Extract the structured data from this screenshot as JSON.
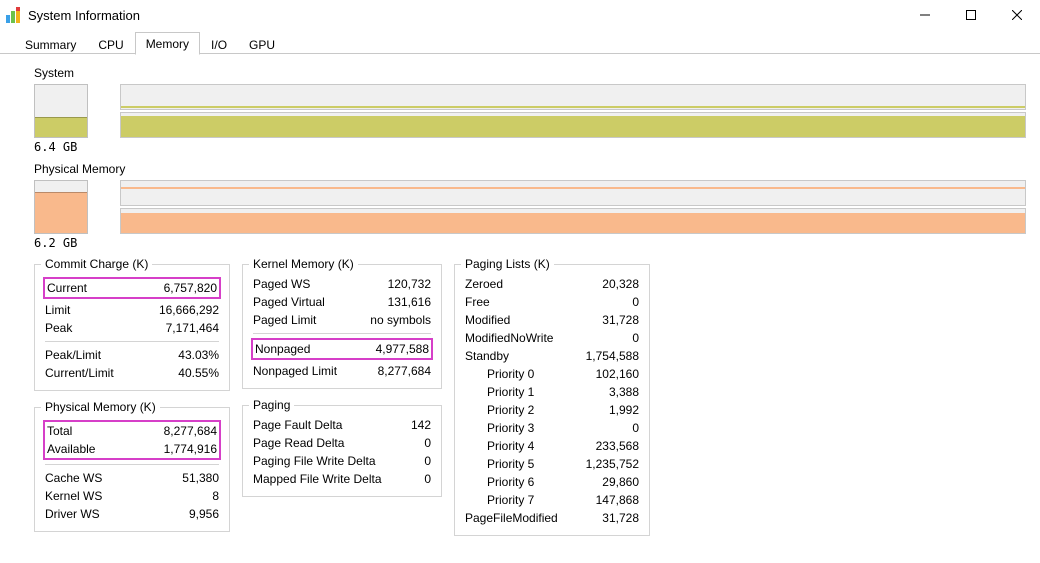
{
  "chrome": {
    "title": "System Information"
  },
  "tabs": {
    "summary": "Summary",
    "cpu": "CPU",
    "memory": "Memory",
    "io": "I/O",
    "gpu": "GPU",
    "active": "memory"
  },
  "graphs": {
    "system": {
      "label": "System",
      "caption": "6.4 GB",
      "fill_pct": 38
    },
    "physical": {
      "label": "Physical Memory",
      "caption": "6.2 GB",
      "fill_pct": 78
    }
  },
  "commit_charge": {
    "legend": "Commit Charge (K)",
    "current_k": "Current",
    "current_v": "6,757,820",
    "limit_k": "Limit",
    "limit_v": "16,666,292",
    "peak_k": "Peak",
    "peak_v": "7,171,464",
    "peaklimit_k": "Peak/Limit",
    "peaklimit_v": "43.03%",
    "currlimit_k": "Current/Limit",
    "currlimit_v": "40.55%"
  },
  "physical_memory": {
    "legend": "Physical Memory (K)",
    "total_k": "Total",
    "total_v": "8,277,684",
    "available_k": "Available",
    "available_v": "1,774,916",
    "cache_k": "Cache WS",
    "cache_v": "51,380",
    "kernel_k": "Kernel WS",
    "kernel_v": "8",
    "driver_k": "Driver WS",
    "driver_v": "9,956"
  },
  "kernel_memory": {
    "legend": "Kernel Memory (K)",
    "pagedws_k": "Paged WS",
    "pagedws_v": "120,732",
    "pagedvirt_k": "Paged Virtual",
    "pagedvirt_v": "131,616",
    "pagedlimit_k": "Paged Limit",
    "pagedlimit_v": "no symbols",
    "nonpaged_k": "Nonpaged",
    "nonpaged_v": "4,977,588",
    "nonpagedlimit_k": "Nonpaged Limit",
    "nonpagedlimit_v": "8,277,684"
  },
  "paging": {
    "legend": "Paging",
    "pfd_k": "Page Fault Delta",
    "pfd_v": "142",
    "prd_k": "Page Read Delta",
    "prd_v": "0",
    "pfwd_k": "Paging File Write Delta",
    "pfwd_v": "0",
    "mfwd_k": "Mapped File Write Delta",
    "mfwd_v": "0"
  },
  "paging_lists": {
    "legend": "Paging Lists (K)",
    "zeroed_k": "Zeroed",
    "zeroed_v": "20,328",
    "free_k": "Free",
    "free_v": "0",
    "modified_k": "Modified",
    "modified_v": "31,728",
    "modnw_k": "ModifiedNoWrite",
    "modnw_v": "0",
    "standby_k": "Standby",
    "standby_v": "1,754,588",
    "p0_k": "Priority 0",
    "p0_v": "102,160",
    "p1_k": "Priority 1",
    "p1_v": "3,388",
    "p2_k": "Priority 2",
    "p2_v": "1,992",
    "p3_k": "Priority 3",
    "p3_v": "0",
    "p4_k": "Priority 4",
    "p4_v": "233,568",
    "p5_k": "Priority 5",
    "p5_v": "1,235,752",
    "p6_k": "Priority 6",
    "p6_v": "29,860",
    "p7_k": "Priority 7",
    "p7_v": "147,868",
    "pfm_k": "PageFileModified",
    "pfm_v": "31,728"
  },
  "colors": {
    "system_fill": "#cccc66",
    "physical_fill": "#f9b98c",
    "highlight": "#d63fc8"
  }
}
